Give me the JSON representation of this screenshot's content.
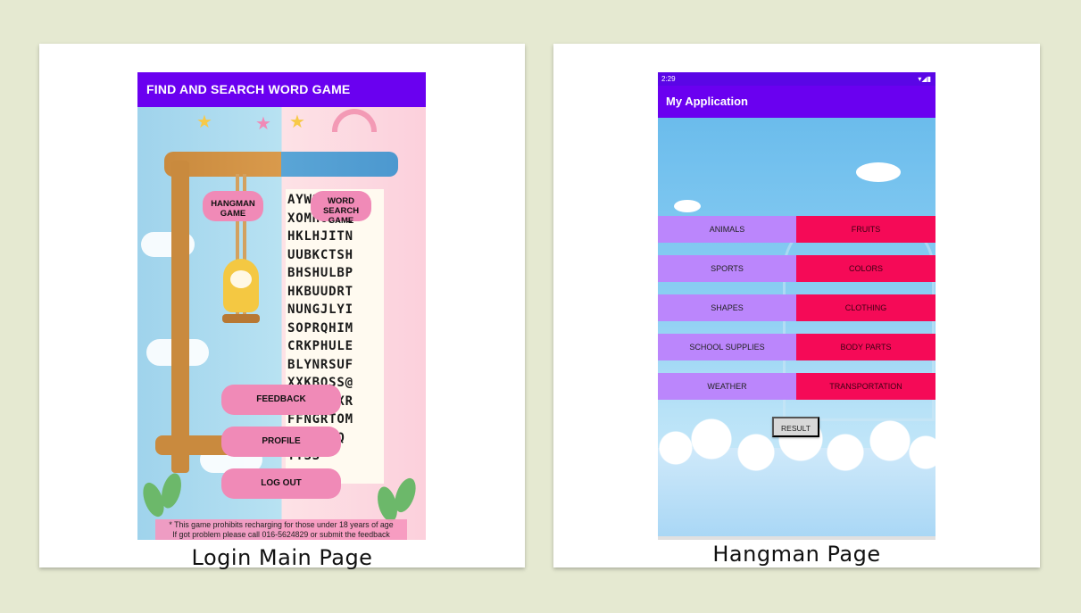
{
  "left_card": {
    "caption": "Login Main Page",
    "app_title": "FIND AND SEARCH WORD GAME",
    "hangman_button": "HANGMAN GAME",
    "word_search_button": "WORD SEARCH GAME",
    "feedback_button": "FEEDBACK",
    "profile_button": "PROFILE",
    "logout_button": "LOG OUT",
    "notice_line1": "* This game prohibits recharging for those under 18 years of age",
    "notice_line2": "If got problem please call 016-5624829 or submit the feedback",
    "grid_letters": "AYWSRBPE\nXOMHOPFE\nHKLHJITN\nUUBKCTSH\nBHSHULBP\nHKBUUDRT\nNUNGJLYI\nSOPRQHIM\nCRKPHULE\nBLYNRSUF\nXXKBOSS@\nJMNOGPXR\nFFNGRTOM\nPQUNPSQ\nYYSS\nCQZ",
    "colors": {
      "appbar": "#6a00f0",
      "button_pink": "#f08ab7"
    }
  },
  "right_card": {
    "caption": "Hangman Page",
    "status_time": "2:29",
    "status_icons": "▾◢▮",
    "app_title": "My Application",
    "categories_left": [
      "ANIMALS",
      "SPORTS",
      "SHAPES",
      "SCHOOL SUPPLIES",
      "WEATHER"
    ],
    "categories_right": [
      "FRUITS",
      "COLORS",
      "CLOTHING",
      "BODY PARTS",
      "TRANSPORTATION"
    ],
    "result_button": "RESULT",
    "colors": {
      "appbar": "#6a00f0",
      "left_button": "#bb86fc",
      "right_button": "#f50a57"
    }
  }
}
